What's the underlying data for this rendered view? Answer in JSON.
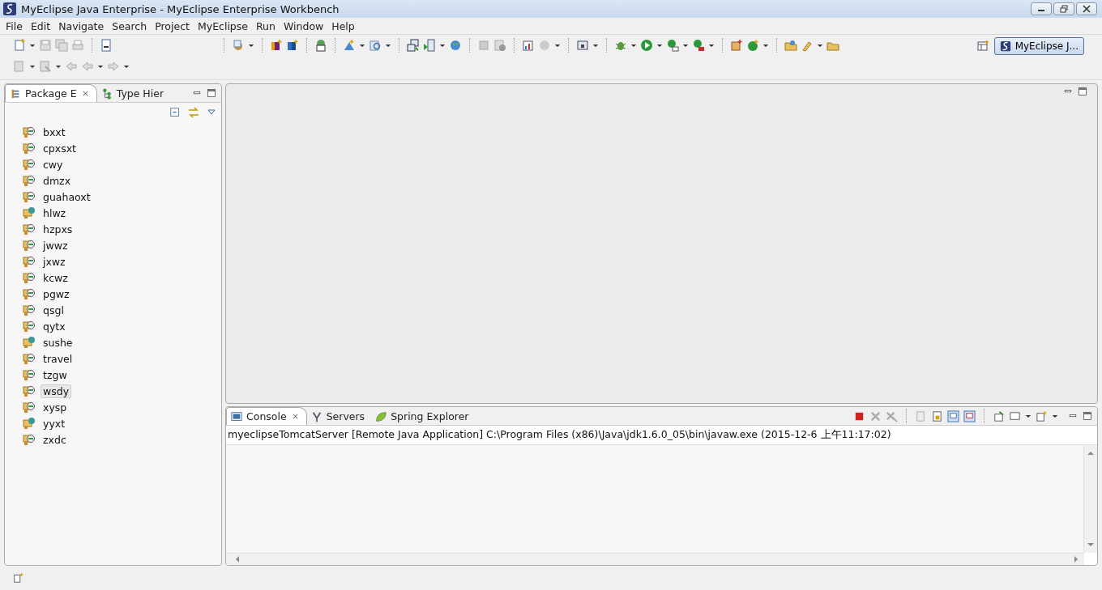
{
  "window": {
    "title": "MyEclipse Java Enterprise - MyEclipse Enterprise Workbench"
  },
  "menu": [
    "File",
    "Edit",
    "Navigate",
    "Search",
    "Project",
    "MyEclipse",
    "Run",
    "Window",
    "Help"
  ],
  "perspective": {
    "label": "MyEclipse J..."
  },
  "left_panel": {
    "tabs": [
      {
        "label": "Package E",
        "selected": true,
        "closable": true
      },
      {
        "label": "Type Hier",
        "selected": false,
        "closable": false
      }
    ],
    "projects": [
      {
        "name": "bxxt",
        "kind": "java",
        "selected": false
      },
      {
        "name": "cpxsxt",
        "kind": "java",
        "selected": false
      },
      {
        "name": "cwy",
        "kind": "java",
        "selected": false
      },
      {
        "name": "dmzx",
        "kind": "java",
        "selected": false
      },
      {
        "name": "guahaoxt",
        "kind": "java",
        "selected": false
      },
      {
        "name": "hlwz",
        "kind": "web",
        "selected": false
      },
      {
        "name": "hzpxs",
        "kind": "java",
        "selected": false
      },
      {
        "name": "jwwz",
        "kind": "java",
        "selected": false
      },
      {
        "name": "jxwz",
        "kind": "java",
        "selected": false
      },
      {
        "name": "kcwz",
        "kind": "java",
        "selected": false
      },
      {
        "name": "pgwz",
        "kind": "java",
        "selected": false
      },
      {
        "name": "qsgl",
        "kind": "java",
        "selected": false
      },
      {
        "name": "qytx",
        "kind": "java",
        "selected": false
      },
      {
        "name": "sushe",
        "kind": "web",
        "selected": false
      },
      {
        "name": "travel",
        "kind": "java",
        "selected": false
      },
      {
        "name": "tzgw",
        "kind": "java",
        "selected": false
      },
      {
        "name": "wsdy",
        "kind": "java",
        "selected": true
      },
      {
        "name": "xysp",
        "kind": "java",
        "selected": false
      },
      {
        "name": "yyxt",
        "kind": "web",
        "selected": false
      },
      {
        "name": "zxdc",
        "kind": "java",
        "selected": false
      }
    ]
  },
  "console_panel": {
    "tabs": [
      {
        "label": "Console",
        "selected": true,
        "closable": true
      },
      {
        "label": "Servers",
        "selected": false,
        "closable": false
      },
      {
        "label": "Spring Explorer",
        "selected": false,
        "closable": false
      }
    ],
    "header": "myeclipseTomcatServer [Remote Java Application] C:\\Program Files (x86)\\Java\\jdk1.6.0_05\\bin\\javaw.exe (2015-12-6 上午11:17:02)"
  }
}
